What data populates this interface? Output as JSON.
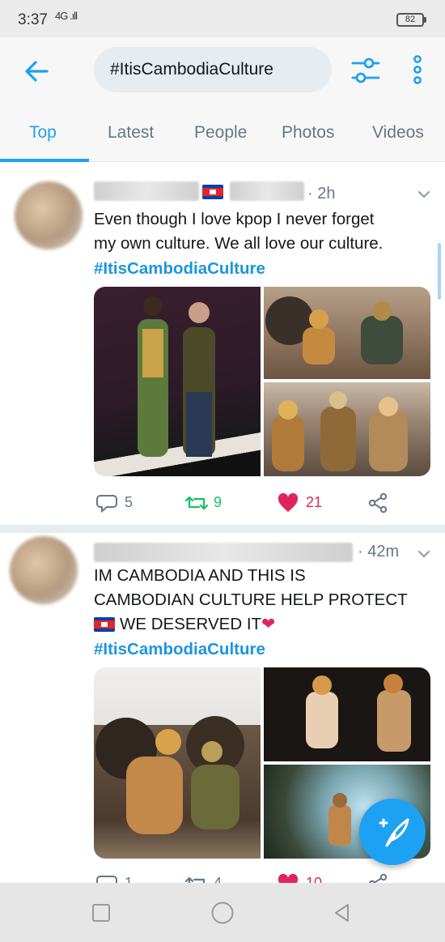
{
  "status_bar": {
    "time": "3:37",
    "signal": "4G .ıll",
    "battery": "82"
  },
  "top_bar": {
    "search_query": "#ItisCambodiaCulture",
    "icons": [
      "back-arrow-icon",
      "filter-sliders-icon",
      "more-vertical-icon"
    ]
  },
  "tabs": [
    {
      "label": "Top",
      "active": true
    },
    {
      "label": "Latest",
      "active": false
    },
    {
      "label": "People",
      "active": false
    },
    {
      "label": "Photos",
      "active": false
    },
    {
      "label": "Videos",
      "active": false
    }
  ],
  "tweets": [
    {
      "time": "· 2h",
      "lines": [
        "Even though I love kpop I never forget",
        "my own culture. We all love our culture."
      ],
      "hashtag": "#ItisCambodiaCulture",
      "replies": "5",
      "retweets": "9",
      "likes": "21"
    },
    {
      "time": "· 42m",
      "lines": [
        "IM CAMBODIA AND THIS IS",
        "CAMBODIAN CULTURE HELP PROTECT",
        "WE DESERVED IT"
      ],
      "hashtag": "#ItisCambodiaCulture",
      "replies": "1",
      "retweets": "4",
      "likes": "10"
    }
  ],
  "colors": {
    "accent": "#1da1f2",
    "hashtag": "#1b95e0",
    "retweet": "#17bf63",
    "like": "#e0245e"
  }
}
